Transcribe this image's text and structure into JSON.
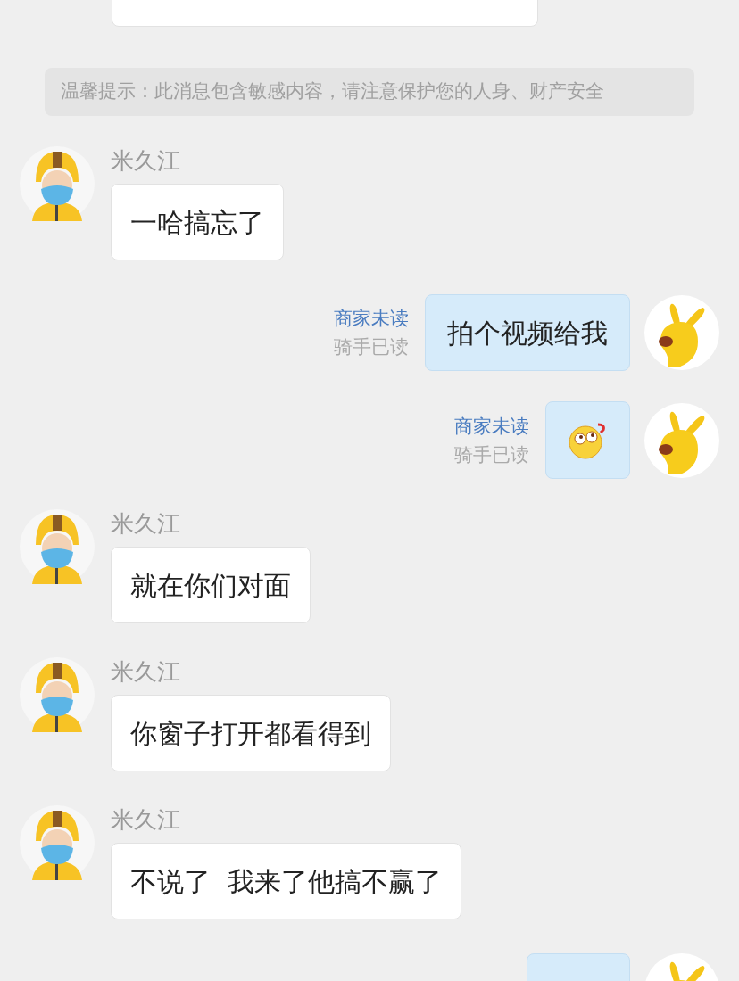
{
  "messages": [
    {
      "kind": "incoming_cut"
    },
    {
      "kind": "notice",
      "text": "温馨提示：此消息包含敏感内容，请注意保护您的人身、财产安全"
    },
    {
      "kind": "incoming",
      "sender": "米久江",
      "text": "一哈搞忘了"
    },
    {
      "kind": "outgoing_text",
      "text": "拍个视频给我",
      "receipts": [
        {
          "text": "商家未读",
          "read": false
        },
        {
          "text": "骑手已读",
          "read": true
        }
      ]
    },
    {
      "kind": "outgoing_sticker",
      "receipts": [
        {
          "text": "商家未读",
          "read": false
        },
        {
          "text": "骑手已读",
          "read": true
        }
      ]
    },
    {
      "kind": "incoming",
      "sender": "米久江",
      "text": "就在你们对面"
    },
    {
      "kind": "incoming",
      "sender": "米久江",
      "text": "你窗子打开都看得到"
    },
    {
      "kind": "incoming",
      "sender": "米久江",
      "text": "不说了  我来了他搞不赢了"
    },
    {
      "kind": "outgoing_cut"
    }
  ]
}
